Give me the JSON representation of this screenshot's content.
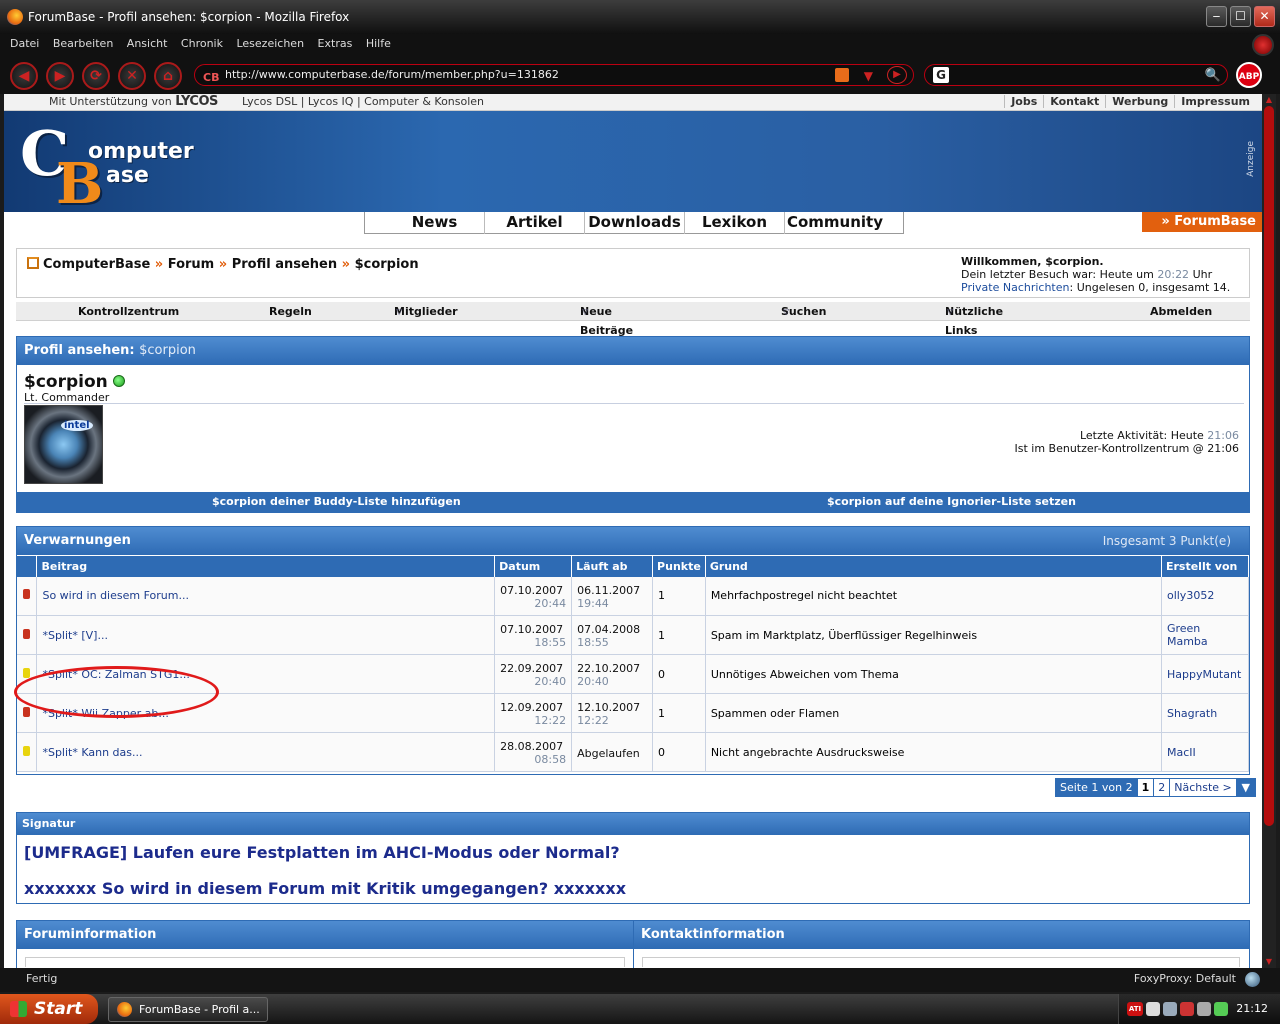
{
  "window": {
    "title": "ForumBase - Profil ansehen: $corpion - Mozilla Firefox",
    "min_label": "‒",
    "max_label": "☐",
    "close_label": "✕"
  },
  "menu": [
    "Datei",
    "Bearbeiten",
    "Ansicht",
    "Chronik",
    "Lesezeichen",
    "Extras",
    "Hilfe"
  ],
  "nav": {
    "back_label": "◀",
    "forward_label": "▶",
    "reload_label": "⟳",
    "stop_label": "✕",
    "home_label": "⌂",
    "url": "http://www.computerbase.de/forum/member.php?u=131862",
    "search_value": "",
    "abp_label": "ABP"
  },
  "site": {
    "sponsor_prefix": "Mit Unterstützung von",
    "sponsor_brand": "LYCOS",
    "top_links": "Lycos DSL | Lycos IQ | Computer & Konsolen",
    "right_links": [
      "Jobs",
      "Kontakt",
      "Werbung",
      "Impressum"
    ],
    "logo_c": "C",
    "logo_omputer": "omputer",
    "logo_b": "B",
    "logo_ase": "ase",
    "ad_label": "Anzeige",
    "main_tabs": [
      "News",
      "Artikel",
      "Downloads",
      "Lexikon",
      "Community"
    ],
    "forumbase_tab": "» ForumBase"
  },
  "breadcrumb": {
    "items": [
      "ComputerBase",
      "Forum",
      "Profil ansehen",
      "$corpion"
    ],
    "sep": "»"
  },
  "welcome": {
    "greeting": "Willkommen, $corpion.",
    "last_visit_prefix": "Dein letzter Besuch war: Heute um",
    "last_visit_time": "20:22",
    "last_visit_suffix": "Uhr",
    "pm_link": "Private Nachrichten",
    "pm_text": ": Ungelesen 0, insgesamt 14."
  },
  "subnav": [
    "Kontrollzentrum",
    "Regeln",
    "Mitglieder",
    "Neue Beiträge",
    "Suchen",
    "Nützliche Links",
    "Abmelden"
  ],
  "profile": {
    "head_label": "Profil ansehen:",
    "head_name": "$corpion",
    "username": "$corpion",
    "rank": "Lt. Commander",
    "avatar_text": "intel",
    "last_activity_prefix": "Letzte Aktivität: Heute",
    "last_activity_time": "21:06",
    "location_line": "Ist im Benutzer-Kontrollzentrum @ 21:06",
    "buddy_link": "$corpion deiner Buddy-Liste hinzufügen",
    "ignore_link": "$corpion auf deine Ignorier-Liste setzen"
  },
  "warnings": {
    "title": "Verwarnungen",
    "total": "Insgesamt 3 Punkt(e)",
    "columns": [
      "Beitrag",
      "Datum",
      "Läuft ab",
      "Punkte",
      "Grund",
      "Erstellt von"
    ],
    "rows": [
      {
        "color": "#c8321e",
        "post": "So wird in diesem Forum...",
        "date": "07.10.2007",
        "date_time": "20:44",
        "expires": "06.11.2007",
        "expires_time": "19:44",
        "points": "1",
        "reason": "Mehrfachpostregel nicht beachtet",
        "by": "olly3052"
      },
      {
        "color": "#c8321e",
        "post": "*Split* [V]...",
        "date": "07.10.2007",
        "date_time": "18:55",
        "expires": "07.04.2008",
        "expires_time": "18:55",
        "points": "1",
        "reason": "Spam im Marktplatz, Überflüssiger Regelhinweis",
        "by": "Green Mamba"
      },
      {
        "color": "#e8d40e",
        "post": "*Split* OC: Zalman STG1...",
        "date": "22.09.2007",
        "date_time": "20:40",
        "expires": "22.10.2007",
        "expires_time": "20:40",
        "points": "0",
        "reason": "Unnötiges Abweichen vom Thema",
        "by": "HappyMutant"
      },
      {
        "color": "#c8321e",
        "post": "*Split* Wii Zapper ab...",
        "date": "12.09.2007",
        "date_time": "12:22",
        "expires": "12.10.2007",
        "expires_time": "12:22",
        "points": "1",
        "reason": "Spammen oder Flamen",
        "by": "Shagrath"
      },
      {
        "color": "#e8d40e",
        "post": "*Split* Kann das...",
        "date": "28.08.2007",
        "date_time": "08:58",
        "expires": "Abgelaufen",
        "expires_time": "",
        "points": "0",
        "reason": "Nicht angebrachte Ausdrucksweise",
        "by": "MacII"
      }
    ]
  },
  "pager": {
    "label": "Seite 1 von 2",
    "current": "1",
    "next_page": "2",
    "next_label": "Nächste >",
    "dropdown": "▼"
  },
  "signature": {
    "title": "Signatur",
    "line1": "[UMFRAGE] Laufen eure Festplatten im AHCI-Modus oder Normal?",
    "line2": "xxxxxxx So wird in diesem Forum mit Kritik umgegangen? xxxxxxx"
  },
  "bottom_panels": [
    "Foruminformation",
    "Kontaktinformation"
  ],
  "status": {
    "left": "Fertig",
    "right": "FoxyProxy: Default"
  },
  "taskbar": {
    "start": "Start",
    "task": "ForumBase - Profil a...",
    "clock": "21:12",
    "tray_ati": "ATI"
  }
}
